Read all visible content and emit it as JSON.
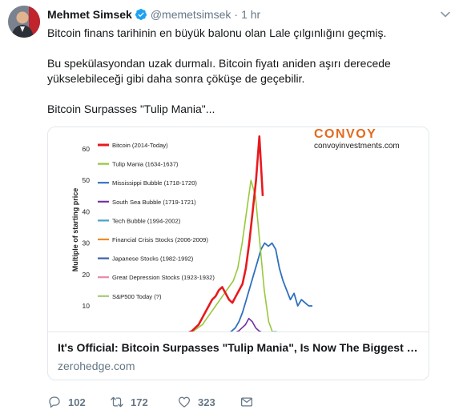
{
  "author": {
    "name": "Mehmet Simsek",
    "handle": "@memetsimsek",
    "separator": "·",
    "time": "1 hr"
  },
  "tweet": {
    "line1": "Bitcoin finans tarihinin en büyük balonu olan Lale çılgınlığını geçmiş.",
    "line2": "Bu spekülasyondan uzak durmalı. Bitcoin fiyatı aniden aşırı derecede",
    "line3": "yükselebileceği gibi daha sonra çöküşe de geçebilir.",
    "line4": "Bitcoin Surpasses \"Tulip Mania\"..."
  },
  "card": {
    "title": "It's Official: Bitcoin Surpasses \"Tulip Mania\", Is Now The Biggest Bub...",
    "domain": "zerohedge.com"
  },
  "actions": {
    "replies": "102",
    "retweets": "172",
    "likes": "323"
  },
  "icons": {
    "verified": "verified-badge-icon",
    "caret": "chevron-down-icon",
    "reply": "reply-icon",
    "retweet": "retweet-icon",
    "like": "heart-icon",
    "dm": "envelope-icon"
  },
  "colors": {
    "verified": "#1da1f2",
    "muted": "#657786",
    "text": "#14171a",
    "border": "#e1e8ed"
  },
  "chart_data": {
    "type": "line",
    "brand": "CONVOY",
    "brand_url": "convoyinvestments.com",
    "ylabel": "Multiple of starting price",
    "yticks": [
      "60",
      "50",
      "40",
      "30",
      "20",
      "10"
    ],
    "ylim": [
      0,
      65
    ],
    "series": [
      {
        "name": "Bitcoin (2014-Today)",
        "color": "#e8191e",
        "values": [
          0.5,
          0.5,
          0.6,
          0.6,
          0.8,
          1,
          1.5,
          2,
          3,
          4,
          6,
          8,
          10,
          12,
          13,
          15,
          16,
          14,
          12,
          11,
          13,
          15,
          17,
          22,
          30,
          40,
          50,
          64,
          45
        ]
      },
      {
        "name": "Tulip Mania (1634-1637)",
        "color": "#97c93d",
        "values": [
          1,
          1,
          1.5,
          2,
          3,
          4,
          6,
          8,
          10,
          12,
          14,
          16,
          18,
          22,
          30,
          40,
          50,
          45,
          30,
          15,
          5,
          1,
          0.5,
          0.5
        ]
      },
      {
        "name": "Mississippi Bubble (1718-1720)",
        "color": "#2f6fbf",
        "values": [
          1,
          1,
          2,
          3,
          5,
          8,
          12,
          16,
          20,
          24,
          28,
          30,
          29,
          30,
          28,
          22,
          18,
          15,
          12,
          14,
          10,
          12,
          11,
          10,
          10
        ]
      },
      {
        "name": "South Sea Bubble (1719-1721)",
        "color": "#7030a0",
        "values": [
          1,
          1,
          1.5,
          2,
          3,
          4,
          6,
          5,
          3,
          2,
          1.5,
          1.5
        ]
      },
      {
        "name": "Tech Bubble (1994-2002)",
        "color": "#4aa0c8",
        "values": [
          1,
          1,
          1,
          1.2,
          1.4,
          1.6,
          1.8,
          1.5,
          1.2,
          1
        ]
      },
      {
        "name": "Financial Crisis Stocks (2006-2009)",
        "color": "#f08a24",
        "values": [
          1,
          1,
          1,
          1,
          1,
          1
        ]
      },
      {
        "name": "Japanese Stocks (1982-1992)",
        "color": "#3d5fa8",
        "values": [
          1,
          1,
          1,
          1,
          1,
          1
        ]
      },
      {
        "name": "Great Depression Stocks (1923-1932)",
        "color": "#e88aa8",
        "values": [
          1,
          1,
          1,
          1,
          1,
          1
        ]
      },
      {
        "name": "S&P500 Today (?)",
        "color": "#a8c878",
        "values": [
          1,
          1,
          1,
          1,
          1,
          1
        ]
      }
    ]
  }
}
